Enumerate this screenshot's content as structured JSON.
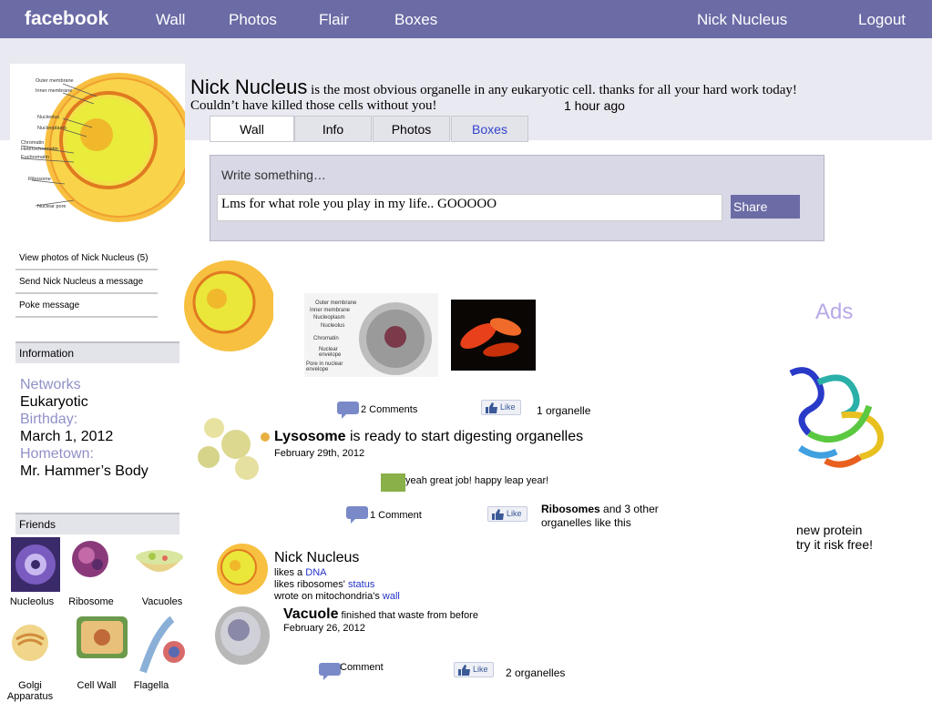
{
  "topbar": {
    "logo": "facebook",
    "nav": [
      "Wall",
      "Photos",
      "Flair",
      "Boxes"
    ],
    "user": "Nick Nucleus",
    "logout": "Logout"
  },
  "status": {
    "name": "Nick Nucleus",
    "text": " is the most obvious organelle in any eukaryotic cell.  thanks for all your hard work today!",
    "text2": "Couldn’t have killed those cells without you!",
    "time": "1 hour ago"
  },
  "tabs": [
    "Wall",
    "Info",
    "Photos",
    "Boxes"
  ],
  "composer": {
    "prompt": "Write something…",
    "value": "Lms for what role you play in my life.. GOOOOO",
    "share": "Share"
  },
  "sidebar": {
    "links": [
      "View photos of Nick Nucleus (5)",
      "Send Nick Nucleus a message",
      "Poke message"
    ],
    "info_header": "Information",
    "info": {
      "networks_label": "Networks",
      "networks": "Eukaryotic",
      "birthday_label": "Birthday:",
      "birthday": "March 1, 2012",
      "hometown_label": "Hometown:",
      "hometown": "Mr. Hammer’s Body"
    },
    "friends_header": "Friends",
    "friends": [
      "Nucleolus",
      "Ribosome",
      "Vacuoles",
      "Golgi Apparatus",
      "Cell Wall",
      "Flagella"
    ]
  },
  "feed": {
    "post1": {
      "comments": "2 Comments",
      "like": "Like",
      "likes": "1 organelle"
    },
    "post2": {
      "author": "Lysosome",
      "text": " is ready to start digesting organelles",
      "date": "February 29th, 2012",
      "comment": "yeah great job! happy leap year!",
      "comments": "1 Comment",
      "like": "Like",
      "likes_name": "Ribosomes",
      "likes_rest": " and 3 other",
      "likes_rest2": "organelles like this"
    },
    "post3": {
      "author": "Nick Nucleus",
      "line1_a": "likes a ",
      "line1_link": "DNA",
      "line2_a": "likes ribosomes' ",
      "line2_link": "status",
      "line3_a": "wrote on mitochondria's ",
      "line3_link": "wall"
    },
    "post4": {
      "author": "Vacuole",
      "text": " finished that waste from before",
      "date": "February 26, 2012",
      "comments": "Comment",
      "like": "Like",
      "likes": "2 organelles"
    }
  },
  "ads": {
    "header": "Ads",
    "line1": "new protein",
    "line2": "try it risk free!"
  },
  "colors": {
    "topbar": "#6b6ba6",
    "band": "#e9e9f1",
    "label": "#9090c8"
  }
}
